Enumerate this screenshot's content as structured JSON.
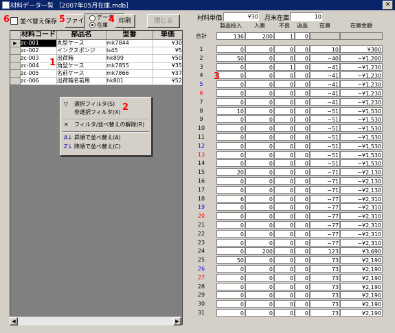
{
  "window": {
    "title": "材料データ一覧  ［2007年05月在庫.mdb］",
    "close_glyph": "✕"
  },
  "toolbar": {
    "save_sort_label": "並べ替え保存",
    "file_button": "ファイル",
    "radio_data": "データ",
    "radio_stock": "在庫",
    "print_button": "印刷",
    "close_button": "閉じる"
  },
  "annotations": {
    "n1": "1",
    "n2": "2",
    "n3": "3",
    "n4": "4",
    "n5": "5",
    "n6": "6"
  },
  "summary": {
    "unit_price_label": "材料単価",
    "unit_price": "¥30",
    "month_end_label": "月末在庫",
    "month_end": "10"
  },
  "left_table": {
    "headers": [
      "材料コード",
      "部品名",
      "型番",
      "単価"
    ],
    "rows": [
      {
        "code": "zc-001",
        "name": "丸型ケース",
        "model": "mk7844",
        "price": "¥30",
        "current": true
      },
      {
        "code": "zc-002",
        "name": "インクスポンジ",
        "model": "is45",
        "price": "¥5"
      },
      {
        "code": "zc-003",
        "name": "出荷箱",
        "model": "hk899",
        "price": "¥50"
      },
      {
        "code": "zc-004",
        "name": "角型ケース",
        "model": "mk7855",
        "price": "¥35"
      },
      {
        "code": "zc-005",
        "name": "名前ケース",
        "model": "mk7866",
        "price": "¥37"
      },
      {
        "code": "zc-006",
        "name": "出荷箱名前用",
        "model": "hk801",
        "price": "¥52"
      }
    ]
  },
  "context_menu": {
    "filter_by_selection": "選択フィルタ(S)",
    "filter_excluding": "非選択フィルタ(X)",
    "remove_filter_sort": "フィルタ/並べ替えの解除(R)",
    "sort_ascending": "昇順で並べ替え(A)",
    "sort_descending": "降順で並べ替え(C)"
  },
  "right_table": {
    "headers": [
      "製品投入",
      "入庫",
      "不良",
      "返品",
      "在庫",
      "在庫金額"
    ],
    "total_label": "合計",
    "totals": [
      "136",
      "200",
      "1",
      "0",
      "",
      ""
    ],
    "rows": [
      {
        "day": "1",
        "v": [
          "0",
          "0",
          "0",
          "0",
          "10",
          "¥300"
        ]
      },
      {
        "day": "2",
        "v": [
          "50",
          "0",
          "0",
          "0",
          "−40",
          "−¥1,200"
        ]
      },
      {
        "day": "3",
        "v": [
          "0",
          "0",
          "1",
          "0",
          "−41",
          "−¥1,230"
        ]
      },
      {
        "day": "4",
        "v": [
          "0",
          "0",
          "0",
          "0",
          "−41",
          "−¥1,230"
        ]
      },
      {
        "day": "5",
        "v": [
          "0",
          "0",
          "0",
          "0",
          "−41",
          "−¥1,230"
        ],
        "color": "blue"
      },
      {
        "day": "6",
        "v": [
          "0",
          "0",
          "0",
          "0",
          "−41",
          "−¥1,230"
        ],
        "color": "red"
      },
      {
        "day": "7",
        "v": [
          "0",
          "0",
          "0",
          "0",
          "−41",
          "−¥1,230"
        ]
      },
      {
        "day": "8",
        "v": [
          "10",
          "0",
          "0",
          "0",
          "−51",
          "−¥1,530"
        ]
      },
      {
        "day": "9",
        "v": [
          "0",
          "0",
          "0",
          "0",
          "−51",
          "−¥1,530"
        ]
      },
      {
        "day": "10",
        "v": [
          "0",
          "0",
          "0",
          "0",
          "−51",
          "−¥1,530"
        ]
      },
      {
        "day": "11",
        "v": [
          "0",
          "0",
          "0",
          "0",
          "−51",
          "−¥1,530"
        ]
      },
      {
        "day": "12",
        "v": [
          "0",
          "0",
          "0",
          "0",
          "−51",
          "−¥1,530"
        ],
        "color": "blue"
      },
      {
        "day": "13",
        "v": [
          "0",
          "0",
          "0",
          "0",
          "−51",
          "−¥1,530"
        ],
        "color": "red"
      },
      {
        "day": "14",
        "v": [
          "0",
          "0",
          "0",
          "0",
          "−51",
          "−¥1,530"
        ]
      },
      {
        "day": "15",
        "v": [
          "20",
          "0",
          "0",
          "0",
          "−71",
          "−¥2,130"
        ]
      },
      {
        "day": "16",
        "v": [
          "0",
          "0",
          "0",
          "0",
          "−71",
          "−¥2,130"
        ]
      },
      {
        "day": "17",
        "v": [
          "0",
          "0",
          "0",
          "0",
          "−71",
          "−¥2,130"
        ]
      },
      {
        "day": "18",
        "v": [
          "6",
          "0",
          "0",
          "0",
          "−77",
          "−¥2,310"
        ]
      },
      {
        "day": "19",
        "v": [
          "0",
          "0",
          "0",
          "0",
          "−77",
          "−¥2,310"
        ],
        "color": "blue"
      },
      {
        "day": "20",
        "v": [
          "0",
          "0",
          "0",
          "0",
          "−77",
          "−¥2,310"
        ],
        "color": "red"
      },
      {
        "day": "21",
        "v": [
          "0",
          "0",
          "0",
          "0",
          "−77",
          "−¥2,310"
        ]
      },
      {
        "day": "22",
        "v": [
          "0",
          "0",
          "0",
          "0",
          "−77",
          "−¥2,310"
        ]
      },
      {
        "day": "23",
        "v": [
          "0",
          "0",
          "0",
          "0",
          "−77",
          "−¥2,310"
        ]
      },
      {
        "day": "24",
        "v": [
          "0",
          "200",
          "0",
          "0",
          "123",
          "¥3,690"
        ]
      },
      {
        "day": "25",
        "v": [
          "50",
          "0",
          "0",
          "0",
          "73",
          "¥2,190"
        ]
      },
      {
        "day": "26",
        "v": [
          "0",
          "0",
          "0",
          "0",
          "73",
          "¥2,190"
        ],
        "color": "blue"
      },
      {
        "day": "27",
        "v": [
          "0",
          "0",
          "0",
          "0",
          "73",
          "¥2,190"
        ],
        "color": "red"
      },
      {
        "day": "28",
        "v": [
          "0",
          "0",
          "0",
          "0",
          "73",
          "¥2,190"
        ]
      },
      {
        "day": "29",
        "v": [
          "0",
          "0",
          "0",
          "0",
          "73",
          "¥2,190"
        ]
      },
      {
        "day": "30",
        "v": [
          "0",
          "0",
          "0",
          "0",
          "73",
          "¥2,190"
        ]
      },
      {
        "day": "31",
        "v": [
          "0",
          "0",
          "0",
          "0",
          "73",
          "¥2,190"
        ]
      }
    ]
  },
  "colors": {
    "titlebar": "#0a246a",
    "window_bg": "#d4d0c8",
    "annotation": "#ff0000",
    "saturday": "#0000ff",
    "sunday": "#ff0000"
  }
}
